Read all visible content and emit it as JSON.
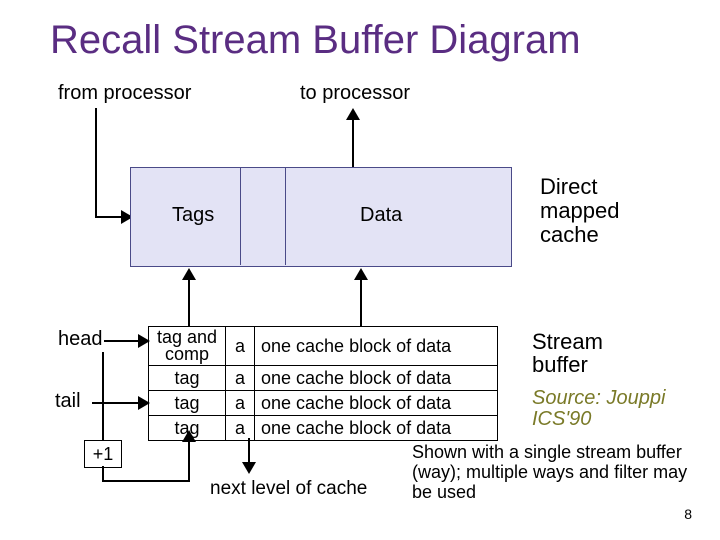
{
  "title": "Recall Stream Buffer Diagram",
  "labels": {
    "from_processor": "from processor",
    "to_processor": "to processor",
    "tags": "Tags",
    "data": "Data",
    "direct_mapped_cache": "Direct\nmapped\ncache",
    "head": "head",
    "tail": "tail",
    "plus_one": "+1",
    "stream_buffer": "Stream\nbuffer",
    "source": "Source: Jouppi ICS'90",
    "next_level": "next level of cache",
    "note": "Shown with a single stream buffer (way); multiple ways and filter may be used"
  },
  "buffer_rows": {
    "r0c0": "tag and comp",
    "r1c0": "tag",
    "r2c0": "tag",
    "r3c0": "tag",
    "a": "a",
    "block": "one cache block of data"
  },
  "page_number": "8"
}
